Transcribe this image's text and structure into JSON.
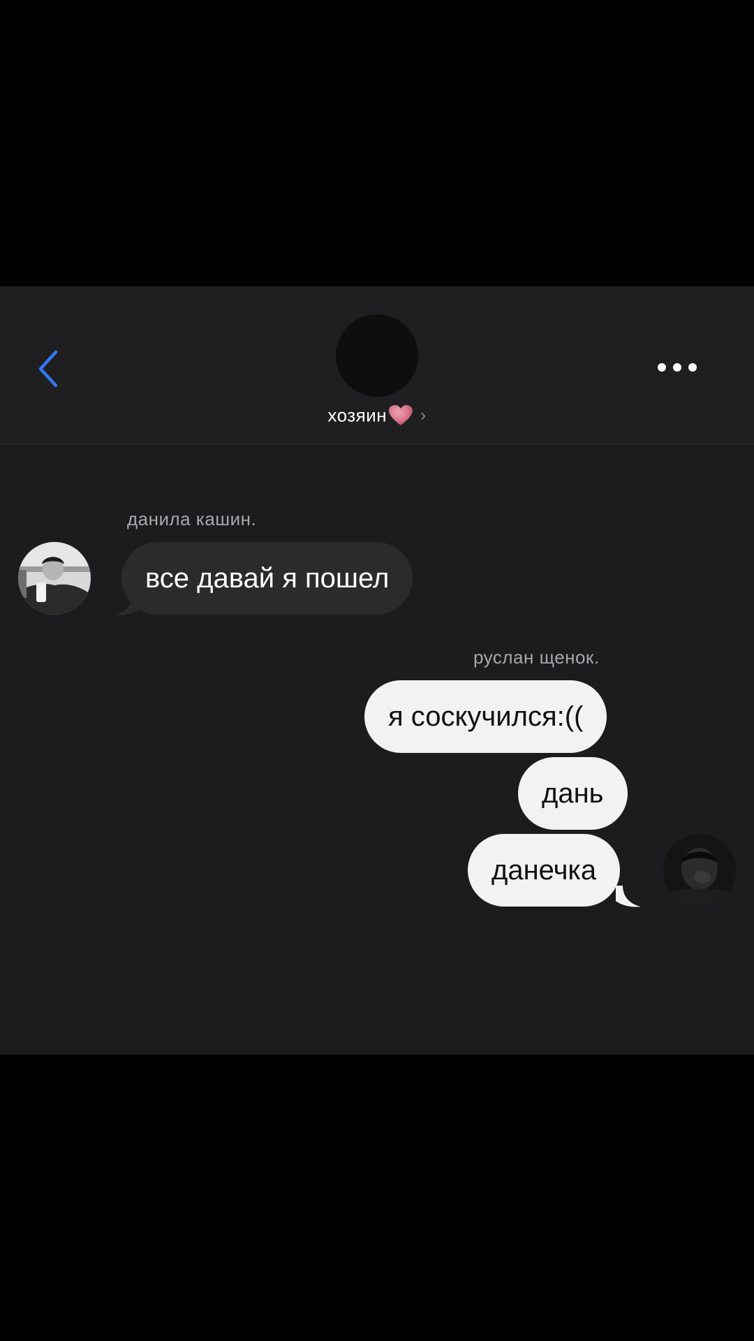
{
  "header": {
    "title": "хозяин",
    "title_suffix_icon": "heart-icon",
    "back_icon": "chevron-left-icon",
    "more_icon": "more-dots-icon",
    "accent_color": "#3478f6"
  },
  "messages": [
    {
      "sender": "данила кашин.",
      "direction": "incoming",
      "texts": [
        "все давай я пошел"
      ]
    },
    {
      "sender": "руслан щенок.",
      "direction": "outgoing",
      "texts": [
        "я соскучился:((",
        "дань",
        "данечка"
      ]
    }
  ],
  "colors": {
    "background": "#1c1c1e",
    "header_background": "#1f1f21",
    "incoming_bubble": "#2b2b2e",
    "outgoing_bubble": "#f2f2f4",
    "heart": "#d9748a"
  }
}
